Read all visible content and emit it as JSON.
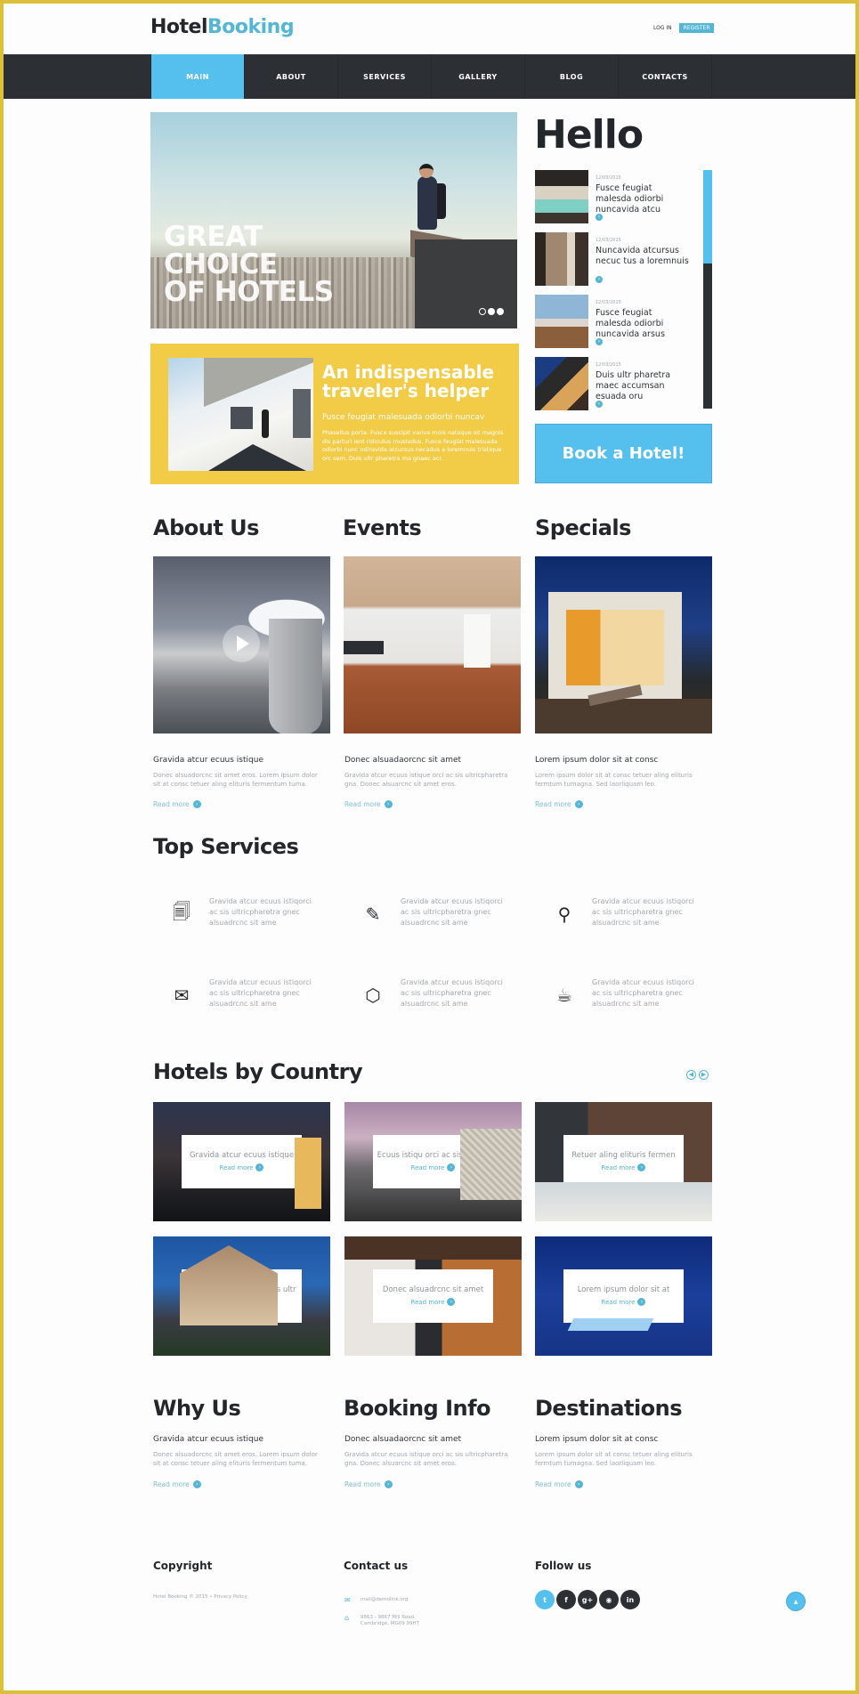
{
  "header": {
    "logo_part1": "Hotel",
    "logo_part2": "Booking",
    "login_label": "Log in",
    "register_label": "Register"
  },
  "nav": {
    "items": [
      {
        "label": "Main",
        "active": true
      },
      {
        "label": "About",
        "active": false
      },
      {
        "label": "Services",
        "active": false
      },
      {
        "label": "Gallery",
        "active": false
      },
      {
        "label": "Blog",
        "active": false
      },
      {
        "label": "Contacts",
        "active": false
      }
    ]
  },
  "hero": {
    "title_lines": [
      "Great",
      "choice",
      "of hotels"
    ],
    "slides": 3,
    "active_slide": 1
  },
  "hello": {
    "title": "Hello",
    "items": [
      {
        "date": "12/03/2015",
        "text": "Fusce feugiat malesda odiorbi nuncavida atcu"
      },
      {
        "date": "12/03/2015",
        "text": "Nuncavida atcursus necuc tus a loremnuis"
      },
      {
        "date": "12/03/2015",
        "text": "Fusce feugiat malesda odiorbi nuncavida arsus"
      },
      {
        "date": "12/03/2015",
        "text": "Duis ultr pharetra maec accumsan esuada oru"
      }
    ]
  },
  "banner": {
    "title": "An indispensable traveler's helper",
    "subtitle": "Fusce feugiat malesuada odiorbi nuncav",
    "body": "Phasellus porta. Fusce suscipit varius mois natoque sit magnis dis parturi ient ridiculus mustadus. Fusce feugiat malesuada odiorbi nunc odiravida atcursus necadus a loremnuis tristique orc sem. Duis ultr pharetra ma gnaec acr."
  },
  "book_button": "Book a Hotel!",
  "section1": {
    "columns": [
      {
        "title": "About Us",
        "subtitle": "Gravida atcur ecuus istique",
        "body": "Donec alsuadorcnc sit amet eros. Lorem ipsum dolor sit at consc tetuer aling elituris fermentum tuma.",
        "link": "Read more"
      },
      {
        "title": "Events",
        "subtitle": "Donec alsuadaorcnc sit amet",
        "body": "Gravida atcur ecuus istique orci ac sis ultricpharetra gna. Donec alsuarcnc sit amet eros.",
        "link": "Read more"
      },
      {
        "title": "Specials",
        "subtitle": "Lorem ipsum dolor sit at consc",
        "body": "Lorem ipsum dolor sit at consc tetuer aling elituris fermtum tumagna. Sed laorliquam leo.",
        "link": "Read more"
      }
    ]
  },
  "services": {
    "title": "Top Services",
    "items": [
      {
        "icon": "documents-icon",
        "glyph": "🗐",
        "text": "Gravida atcur ecuus istiqorci ac sis ultricpharetra gnec alsuadrcnc sit ame"
      },
      {
        "icon": "edit-icon",
        "glyph": "✎",
        "text": "Gravida atcur ecuus istiqorci ac sis ultricpharetra gnec alsuadrcnc sit ame"
      },
      {
        "icon": "lightbulb-icon",
        "glyph": "⚲",
        "text": "Gravida atcur ecuus istiqorci ac sis ultricpharetra gnec alsuadrcnc sit ame"
      },
      {
        "icon": "envelope-icon",
        "glyph": "✉",
        "text": "Gravida atcur ecuus istiqorci ac sis ultricpharetra gnec alsuadrcnc sit ame"
      },
      {
        "icon": "codepen-icon",
        "glyph": "⬡",
        "text": "Gravida atcur ecuus istiqorci ac sis ultricpharetra gnec alsuadrcnc sit ame"
      },
      {
        "icon": "coffee-cup-icon",
        "glyph": "☕",
        "text": "Gravida atcur ecuus istiqorci ac sis ultricpharetra gnec alsuadrcnc sit ame"
      }
    ]
  },
  "hotels_by_country": {
    "title": "Hotels by Country",
    "prev_icon": "◀",
    "next_icon": "▶",
    "tiles": [
      {
        "title": "Gravida atcur ecuus istique",
        "link": "Read more"
      },
      {
        "title": "Ecuus istiqu orci ac sis ultricp",
        "link": "Read more"
      },
      {
        "title": "Retuer aling elituris fermen",
        "link": "Read more"
      },
      {
        "title": "Eur ecuus istiqorci ac sis ultr",
        "link": "Read more"
      },
      {
        "title": "Donec alsuadrcnc sit amet",
        "link": "Read more"
      },
      {
        "title": "Lorem ipsum dolor sit at",
        "link": "Read more"
      }
    ]
  },
  "section2": {
    "columns": [
      {
        "title": "Why Us",
        "subtitle": "Gravida atcur ecuus istique",
        "body": "Donec alsuadorcnc sit amet eros. Lorem ipsum dolor sit at consc tetuer aling elituris fermentum tuma.",
        "link": "Read more"
      },
      {
        "title": "Booking Info",
        "subtitle": "Donec alsuadaorcnc sit amet",
        "body": "Gravida atcur ecuus istique orci ac sis ultricpharetra gna. Donec alsuarcnc sit amet eros.",
        "link": "Read more"
      },
      {
        "title": "Destinations",
        "subtitle": "Lorem ipsum dolor sit at consc",
        "body": "Lorem ipsum dolor sit at consc tetuer aling elituris fermtum tumagna. Sed laorliquam leo.",
        "link": "Read more"
      }
    ]
  },
  "footer": {
    "copyright_title": "Copyright",
    "copyright_text": "Hotel Booking © 2015 • Privacy Policy",
    "contact_title": "Contact us",
    "email": "mail@demolink.org",
    "address_line1": "9863 - 9867 Mill Road,",
    "address_line2": "Cambridge, MG09 99HT",
    "follow_title": "Follow us",
    "socials": [
      {
        "name": "twitter",
        "glyph": "t"
      },
      {
        "name": "facebook",
        "glyph": "f"
      },
      {
        "name": "google-plus",
        "glyph": "g+"
      },
      {
        "name": "rss",
        "glyph": "◉"
      },
      {
        "name": "linkedin",
        "glyph": "in"
      }
    ],
    "to_top_glyph": "▲"
  },
  "colors": {
    "accent": "#55bfee",
    "nav_bg": "#2c3035",
    "banner_yellow": "#f2cc47",
    "frame_border": "#dcbf3a"
  }
}
